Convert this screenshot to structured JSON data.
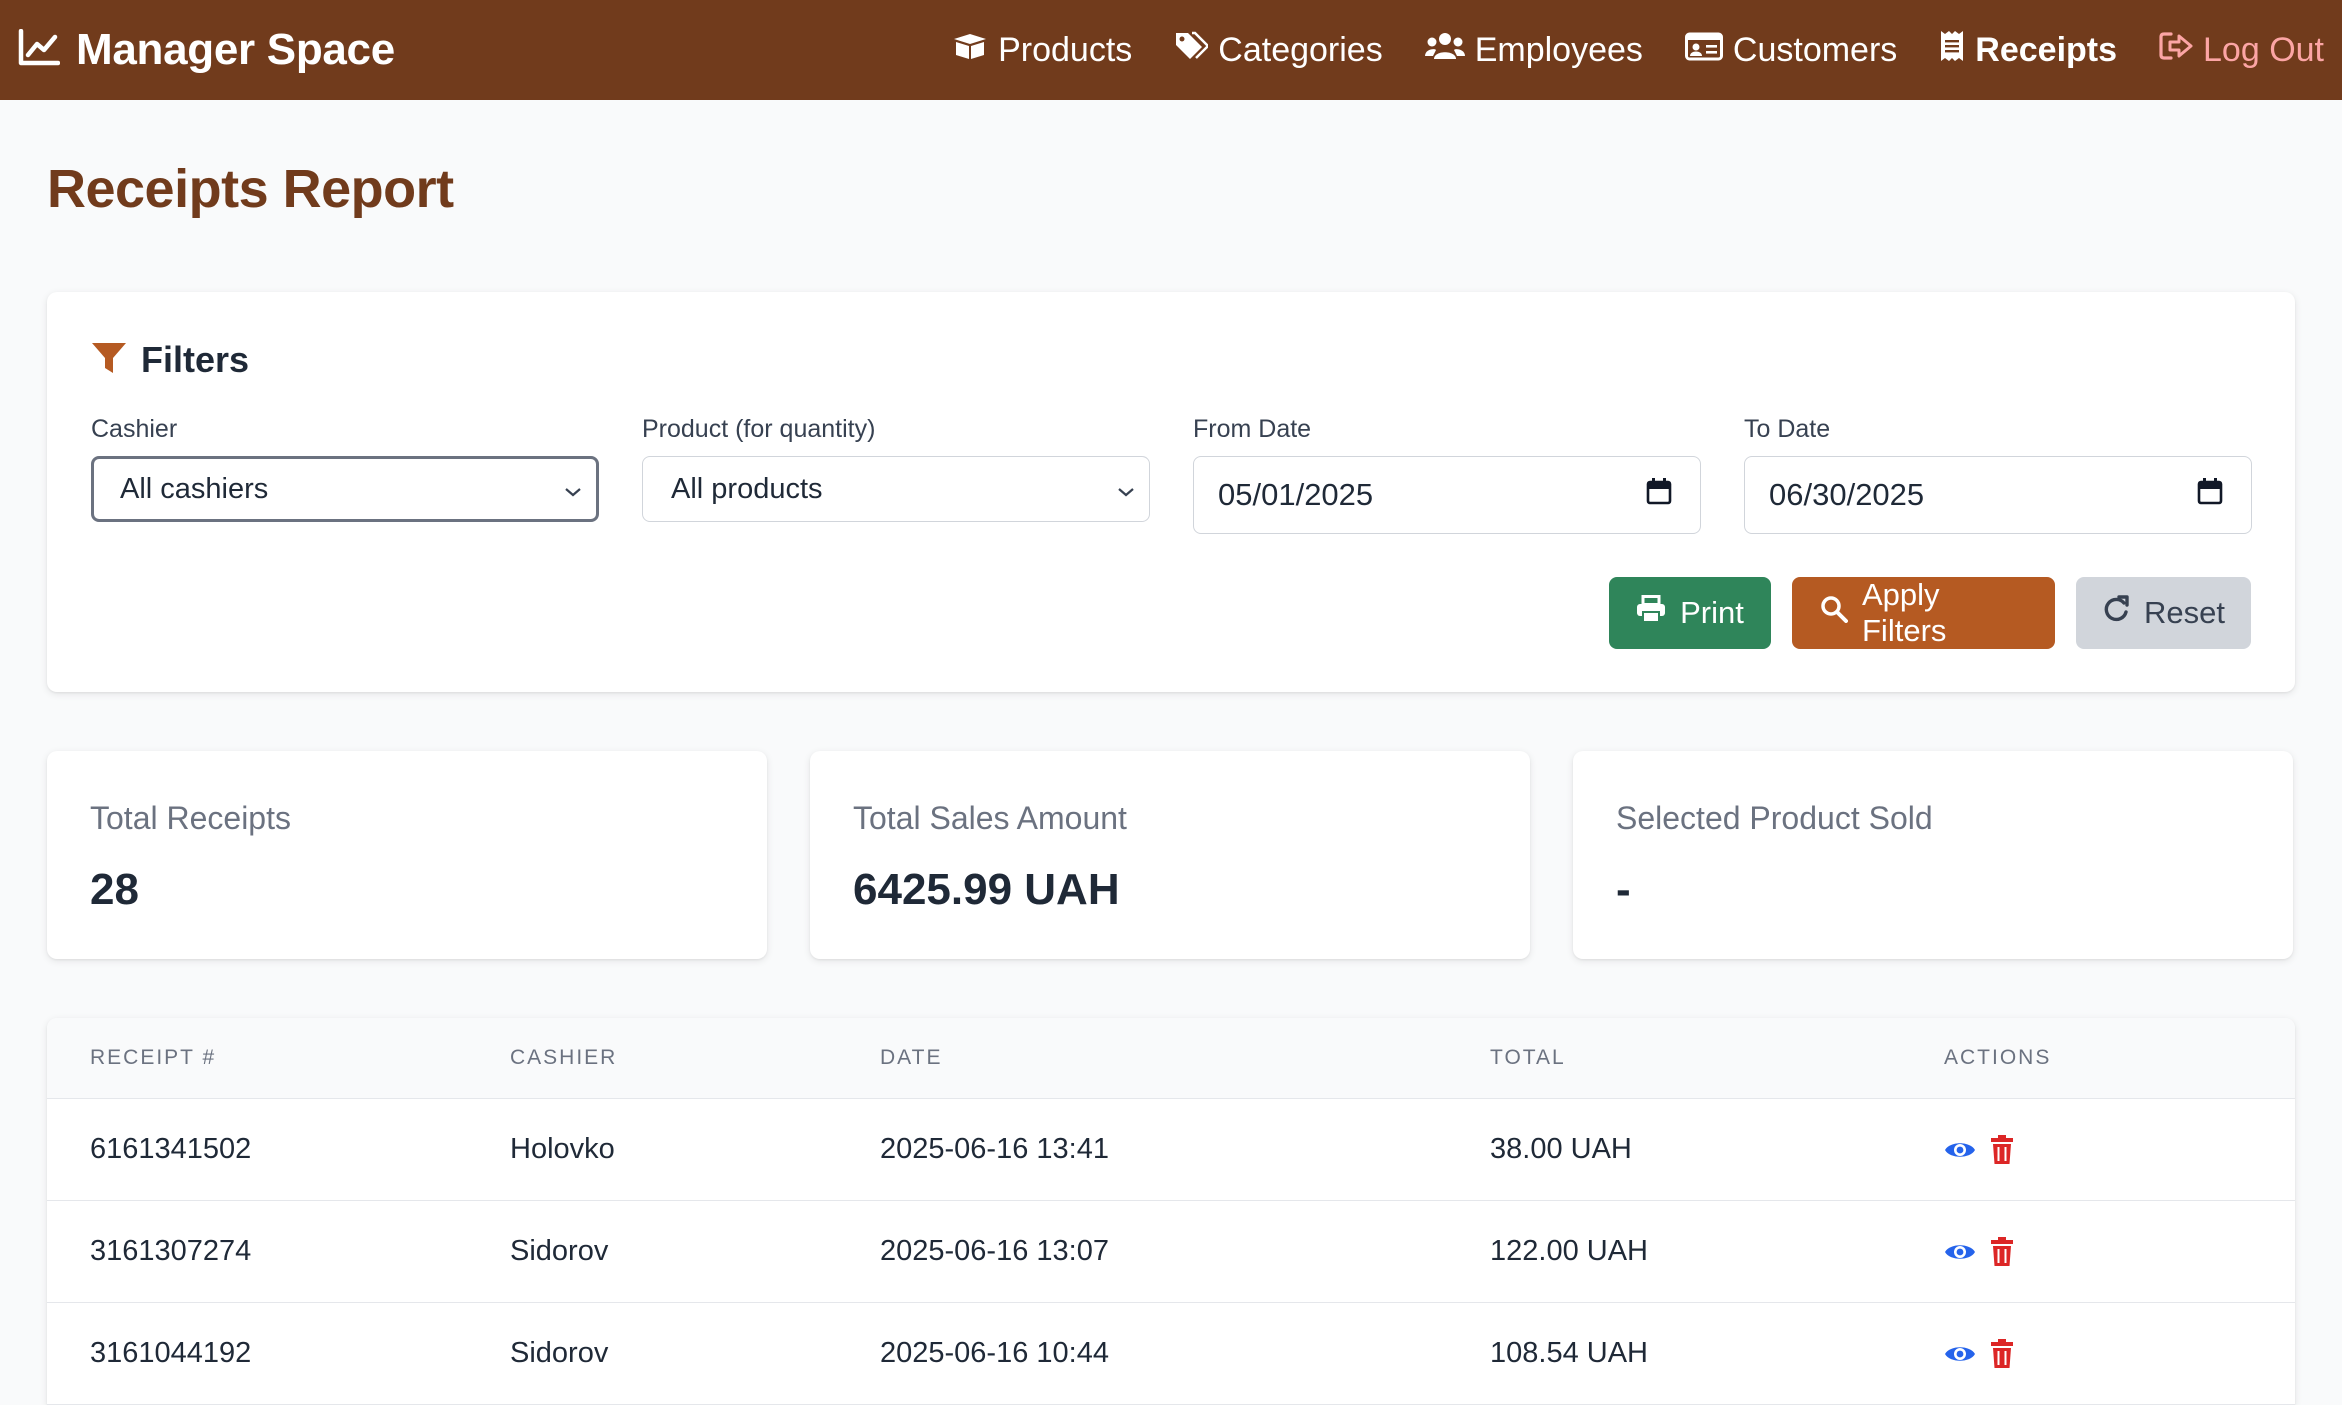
{
  "app": {
    "title": "Manager Space"
  },
  "nav": {
    "items": [
      {
        "label": "Products",
        "icon": "box-icon"
      },
      {
        "label": "Categories",
        "icon": "tags-icon"
      },
      {
        "label": "Employees",
        "icon": "users-icon"
      },
      {
        "label": "Customers",
        "icon": "id-card-icon"
      },
      {
        "label": "Receipts",
        "icon": "receipt-icon",
        "active": true
      },
      {
        "label": "Log Out",
        "icon": "logout-icon"
      }
    ]
  },
  "page": {
    "title": "Receipts Report"
  },
  "filters": {
    "title": "Filters",
    "cashier": {
      "label": "Cashier",
      "value": "All cashiers"
    },
    "product": {
      "label": "Product (for quantity)",
      "value": "All products"
    },
    "from_date": {
      "label": "From Date",
      "value": "05/01/2025"
    },
    "to_date": {
      "label": "To Date",
      "value": "06/30/2025"
    },
    "buttons": {
      "print": "Print",
      "apply": "Apply Filters",
      "reset": "Reset"
    }
  },
  "stats": {
    "total_receipts": {
      "label": "Total Receipts",
      "value": "28"
    },
    "total_sales": {
      "label": "Total Sales Amount",
      "value": "6425.99 UAH"
    },
    "product_sold": {
      "label": "Selected Product Sold",
      "value": "-"
    }
  },
  "table": {
    "headers": [
      "RECEIPT #",
      "CASHIER",
      "DATE",
      "TOTAL",
      "ACTIONS"
    ],
    "rows": [
      {
        "receipt": "6161341502",
        "cashier": "Holovko",
        "date": "2025-06-16 13:41",
        "total": "38.00 UAH"
      },
      {
        "receipt": "3161307274",
        "cashier": "Sidorov",
        "date": "2025-06-16 13:07",
        "total": "122.00 UAH"
      },
      {
        "receipt": "3161044192",
        "cashier": "Sidorov",
        "date": "2025-06-16 10:44",
        "total": "108.54 UAH"
      }
    ]
  },
  "colors": {
    "brand": "#713b1c",
    "title": "#713b1c",
    "print": "#2f855a",
    "apply": "#b55a22",
    "reset": "#d1d5db",
    "view_icon": "#2563eb",
    "delete_icon": "#dc2626",
    "logout": "#fca5a5"
  }
}
